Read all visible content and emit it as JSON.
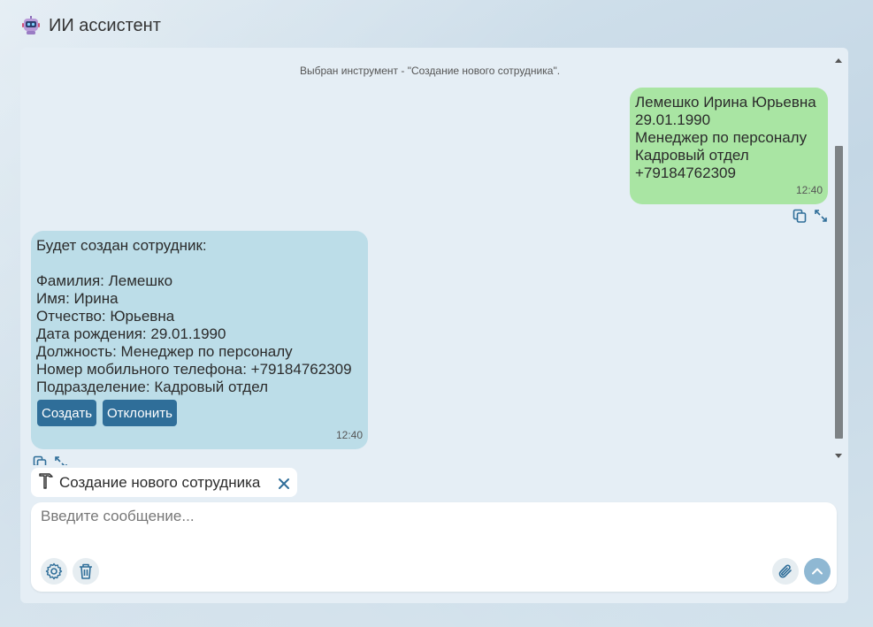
{
  "header": {
    "title": "ИИ ассистент",
    "icon": "robot-icon"
  },
  "chat": {
    "system_note": "Выбран инструмент - \"Создание нового сотрудника\".",
    "user_message": {
      "lines": [
        "Лемешко Ирина Юрьевна",
        "29.01.1990",
        "Менеджер по персоналу",
        "Кадровый отдел",
        "+79184762309"
      ],
      "time": "12:40"
    },
    "bot_message": {
      "lines": [
        "Будет создан сотрудник:",
        "",
        "Фамилия: Лемешко",
        "Имя: Ирина",
        "Отчество: Юрьевна",
        "Дата рождения: 29.01.1990",
        "Должность: Менеджер по персоналу",
        "Номер мобильного телефона: +79184762309",
        "Подразделение: Кадровый отдел"
      ],
      "create_label": "Создать",
      "reject_label": "Отклонить",
      "time": "12:40"
    }
  },
  "tool_chip": {
    "label": "Создание нового сотрудника",
    "icon": "hammer-icon"
  },
  "composer": {
    "placeholder": "Введите сообщение..."
  },
  "colors": {
    "user_bubble": "#a9e5a3",
    "bot_bubble": "#bcdde8",
    "button": "#2f6e99",
    "send": "#8fb8d3"
  }
}
